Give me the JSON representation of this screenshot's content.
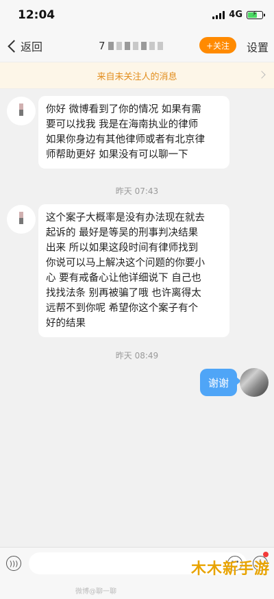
{
  "status_bar": {
    "time": "12:04",
    "network": "4G"
  },
  "nav": {
    "back_label": "返回",
    "contact_name_initial": "7",
    "follow_label": "+关注",
    "settings_label": "设置"
  },
  "notice": {
    "text": "来自未关注人的消息"
  },
  "messages": [
    {
      "direction": "incoming",
      "lines": [
        "你好 微博看到了你的情况 如果有需",
        "要可以找我 我是在海南执业的律师",
        "如果你身边有其他律师或者有北京律",
        "师帮助更好 如果没有可以聊一下"
      ]
    },
    {
      "timestamp": "昨天 07:43"
    },
    {
      "direction": "incoming",
      "lines": [
        "这个案子大概率是没有办法现在就去",
        "起诉的 最好是等吴的刑事判决结果",
        "出来 所以如果这段时间有律师找到",
        "你说可以马上解决这个问题的你要小",
        "心 要有戒备心让他详细说下 自己也",
        "找找法条 别再被骗了哦 也许离得太",
        "远帮不到你呢 希望你这个案子有个",
        "好的结果"
      ]
    },
    {
      "timestamp": "昨天 08:49"
    },
    {
      "direction": "outgoing",
      "text": "谢谢"
    }
  ],
  "input": {
    "placeholder": ""
  },
  "footer": {
    "watermark": "微博@聊一聊"
  },
  "site_logo": "木木新手游",
  "colors": {
    "accent_orange": "#ff8a00",
    "notice_text": "#e28d1d",
    "outgoing_bubble": "#4fa5f7"
  }
}
